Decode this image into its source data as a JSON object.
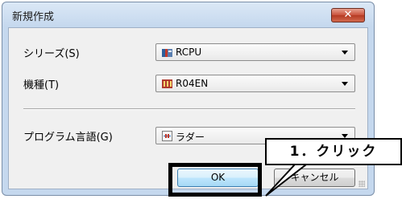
{
  "dialog": {
    "title": "新規作成",
    "close_symbol": "✕"
  },
  "fields": {
    "series": {
      "label": "シリーズ(S)",
      "value": "RCPU",
      "icon": "rcpu-icon"
    },
    "model": {
      "label": "機種(T)",
      "value": "R04EN",
      "icon": "module-icon"
    },
    "language": {
      "label": "プログラム言語(G)",
      "value": "ラダー",
      "icon": "ladder-icon"
    }
  },
  "buttons": {
    "ok": "OK",
    "cancel": "キャンセル"
  },
  "annotation": {
    "callout": "1．クリック"
  },
  "colors": {
    "close_red": "#c9503a",
    "ok_focus": "#3c7fb1",
    "annotation": "#000000"
  }
}
